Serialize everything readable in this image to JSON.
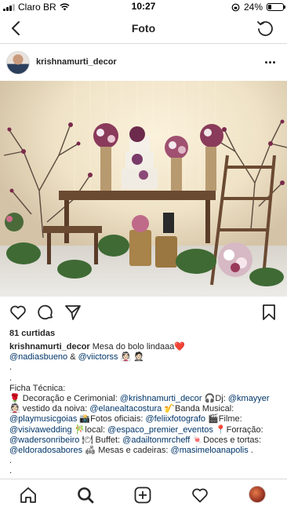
{
  "status_bar": {
    "carrier": "Claro BR",
    "time": "10:27",
    "battery": "24%",
    "battery_level": 0.24
  },
  "header": {
    "title": "Foto"
  },
  "post": {
    "username": "krishnamurti_decor",
    "likes": "81 curtidas"
  },
  "caption": {
    "line1": {
      "user": "krishnamurti_decor",
      "text": " Mesa do bolo lindaaa❤️"
    },
    "line2": {
      "m1": "@nadiasbueno",
      "t1": " & ",
      "m2": "@viictorss",
      "t2": " 👰🏻 🤵🏻"
    },
    "line3": ".",
    "line4": ".",
    "line5": "Ficha Técnica:",
    "line6": {
      "t1": "🌹 Decoração e Cerimonial: ",
      "m1": "@krishnamurti_decor",
      "t2": " 🎧Dj: ",
      "m2": "@kmayyer"
    },
    "line7": {
      "t1": "👰🏻 vestido da noiva: ",
      "m1": "@elanealtacostura",
      "t2": " 🎷Banda Musical:"
    },
    "line8": {
      "m1": "@playmusicgoias",
      "t1": " 📸Fotos oficiais: ",
      "m2": "@feliixfotografo",
      "t2": " 🎬Filme:"
    },
    "line9": {
      "m1": "@visivawedding",
      "t1": " 🎋local: ",
      "m2": "@espaco_premier_eventos",
      "t2": " 📍Forração:"
    },
    "line10": {
      "m1": "@wadersonribeiro",
      "t1": " 🍽 Buffet: ",
      "m2": "@adailtonmrcheff",
      "t2": " 🍬Doces e tortas:"
    },
    "line11": {
      "m1": "@eldoradosabores",
      "t1": " 🛋 Mesas e cadeiras: ",
      "m2": "@masimeloanapolis",
      "t2": " ."
    },
    "line12": ".",
    "line13": "."
  },
  "tabbar": {
    "items": [
      "home-icon",
      "search-icon",
      "new-post-icon",
      "activity-heart-icon",
      "profile-avatar"
    ]
  },
  "colors": {
    "text": "#262626",
    "mention": "#003569",
    "divider": "#dbdbdb",
    "heart": "#e0245e"
  }
}
